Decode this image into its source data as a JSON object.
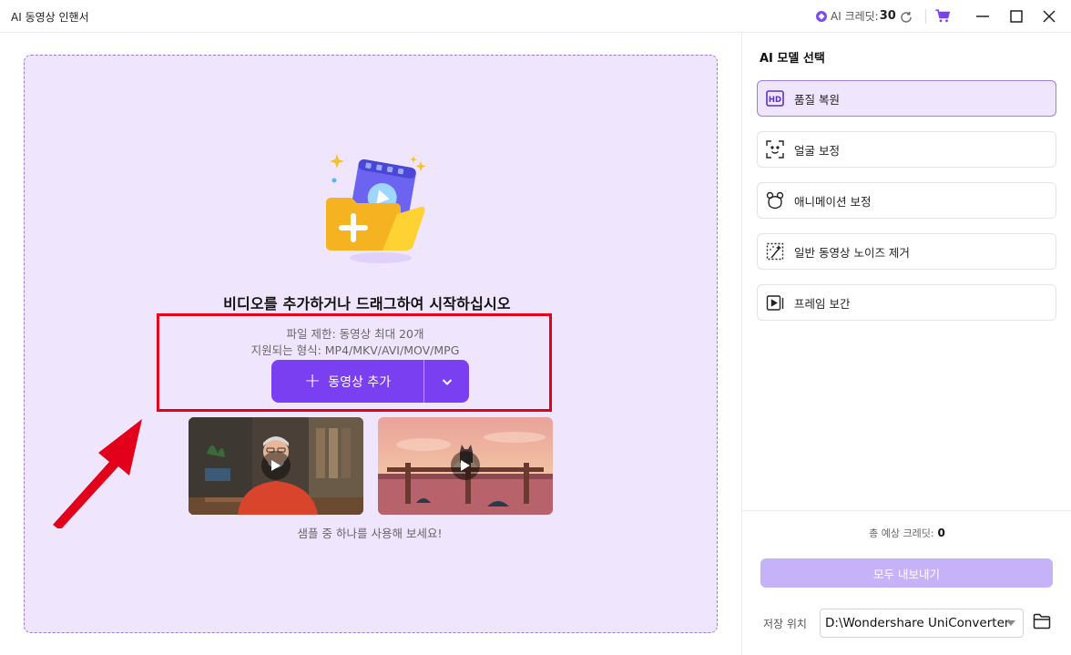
{
  "app": {
    "title": "AI 동영상 인핸서"
  },
  "titlebar": {
    "credit_label": "AI 크레딧:",
    "credit_value": "30"
  },
  "main": {
    "drop_title": "비디오를 추가하거나 드래그하여 시작하십시오",
    "file_limit": "파일 제한: 동영상 최대 20개",
    "formats": "지원되는 형식: MP4/MKV/AVI/MOV/MPG",
    "add_button": "동영상 추가",
    "sample_hint": "샘플 중 하나를 사용해 보세요!"
  },
  "panel": {
    "title": "AI 모델 선택",
    "models": [
      {
        "label": "품질 복원",
        "icon": "hd-icon",
        "selected": true
      },
      {
        "label": "얼굴 보정",
        "icon": "face-scan-icon",
        "selected": false
      },
      {
        "label": "애니메이션 보정",
        "icon": "bear-icon",
        "selected": false
      },
      {
        "label": "일반 동영상 노이즈 제거",
        "icon": "denoise-icon",
        "selected": false
      },
      {
        "label": "프레임 보간",
        "icon": "frame-play-icon",
        "selected": false
      }
    ],
    "total_credit_label": "총 예상 크레딧:",
    "total_credit_value": "0",
    "export_button": "모두 내보내기",
    "save_label": "저장 위치",
    "save_path": "D:\\Wondershare UniConverter"
  },
  "colors": {
    "accent": "#7b3ff2",
    "drop_bg": "#efe6fd",
    "highlight": "#e3001a"
  }
}
